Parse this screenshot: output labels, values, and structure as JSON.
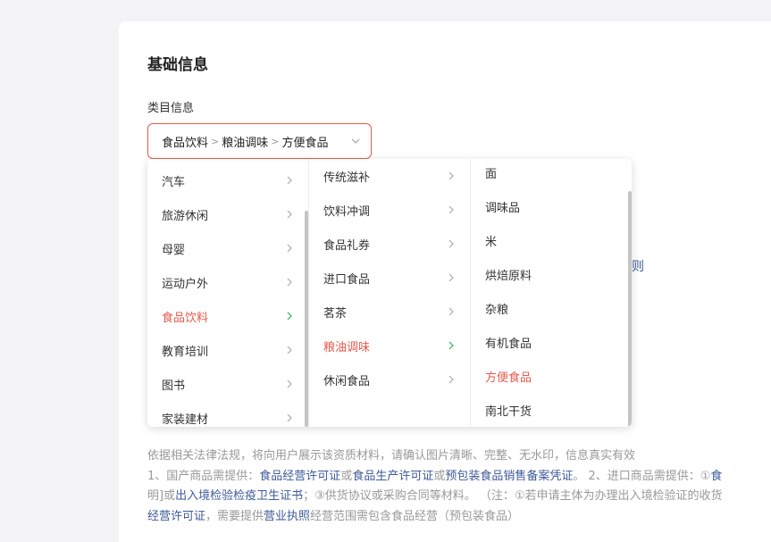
{
  "section": {
    "title": "基础信息",
    "field_label": "类目信息"
  },
  "cascader": {
    "level1": "食品饮料",
    "level2": "粮油调味",
    "level3": "方便食品"
  },
  "menu": {
    "col1": [
      "汽车",
      "旅游休闲",
      "母婴",
      "运动户外",
      "食品饮料",
      "教育培训",
      "图书",
      "家装建材"
    ],
    "col2": [
      "传统滋补",
      "饮料冲调",
      "食品礼券",
      "进口食品",
      "茗茶",
      "粮油调味",
      "休闲食品"
    ],
    "col3": [
      "面",
      "调味品",
      "米",
      "烘焙原料",
      "杂粮",
      "有机食品",
      "方便食品",
      "南北干货"
    ]
  },
  "partial_link": "则",
  "notes": {
    "line1": "依据相关法律法规，将向用户展示该资质材料，请确认图片清晰、完整、无水印，信息真实有效",
    "l2a": "1、国产商品需提供：",
    "l2b": "食品经营许可证",
    "l2c": "或",
    "l2d": "食品生产许可证",
    "l2e": "或",
    "l2f": "预包装食品销售备案凭证",
    "l2g": "。 2、进口商品需提供：①",
    "l2h": "食",
    "l3a": "明]或",
    "l3b": "出入境检验检疫卫生证书",
    "l3c": "；③供货协议或采购合同等材料。   （注：①若申请主体为办理出入境检验证的收货",
    "l4a": "经营许可证",
    "l4b": "，需要提供",
    "l4c": "营业执照",
    "l4d": "经营范围需包含食品经营（预包装食品）"
  },
  "colors": {
    "accent": "#e65a4c",
    "link": "#3d5a99",
    "active_chevron": "#2bb34a"
  }
}
